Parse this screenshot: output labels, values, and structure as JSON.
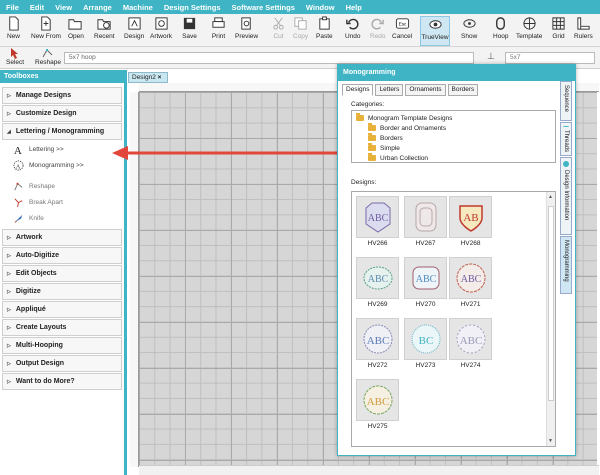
{
  "menu": [
    "File",
    "Edit",
    "View",
    "Arrange",
    "Machine",
    "Design Settings",
    "Software Settings",
    "Window",
    "Help"
  ],
  "toolbar": {
    "buttons": [
      {
        "label": "New",
        "icon": "new-file-icon"
      },
      {
        "label": "New From",
        "icon": "new-from-icon"
      },
      {
        "label": "Open",
        "icon": "open-folder-icon"
      },
      {
        "label": "Recent",
        "icon": "recent-icon"
      },
      {
        "label": "Design",
        "icon": "design-icon"
      },
      {
        "label": "Artwork",
        "icon": "artwork-icon"
      },
      {
        "label": "Save",
        "icon": "save-icon"
      },
      {
        "label": "Print",
        "icon": "print-icon"
      },
      {
        "label": "Preview",
        "icon": "preview-icon"
      },
      {
        "label": "Cut",
        "icon": "cut-icon"
      },
      {
        "label": "Copy",
        "icon": "copy-icon"
      },
      {
        "label": "Paste",
        "icon": "paste-icon"
      },
      {
        "label": "Undo",
        "icon": "undo-icon"
      },
      {
        "label": "Redo",
        "icon": "redo-icon"
      },
      {
        "label": "Cancel",
        "icon": "cancel-icon"
      },
      {
        "label": "TrueView",
        "icon": "trueview-icon"
      },
      {
        "label": "Show",
        "icon": "show-icon"
      },
      {
        "label": "Hoop",
        "icon": "hoop-icon"
      },
      {
        "label": "Template",
        "icon": "template-icon"
      },
      {
        "label": "Grid",
        "icon": "grid-icon"
      },
      {
        "label": "Rulers",
        "icon": "rulers-icon"
      }
    ]
  },
  "optbar": {
    "select": "Select",
    "reshape": "Reshape",
    "hoop_value": "5x7 hoop",
    "right_value": "5x7"
  },
  "sidebar": {
    "title": "Toolboxes",
    "sections": [
      "Manage Designs",
      "Customize Design",
      "Lettering / Monogramming",
      "Artwork",
      "Auto-Digitize",
      "Edit Objects",
      "Digitize",
      "Appliqué",
      "Create Layouts",
      "Multi-Hooping",
      "Output Design",
      "Want to do More?"
    ],
    "tools": [
      "Lettering >>",
      "Monogramming >>",
      "Reshape",
      "Break Apart",
      "Knife"
    ]
  },
  "canvas": {
    "tab": "Design2"
  },
  "panel": {
    "title": "Monogramming",
    "tabs": [
      "Designs",
      "Letters",
      "Ornaments",
      "Borders"
    ],
    "categories_label": "Categories:",
    "categories": [
      "Monogram Template Designs",
      "Border and Ornaments",
      "Borders",
      "Simple",
      "Urban Collection"
    ],
    "designs_label": "Designs:",
    "designs": [
      "HV266",
      "HV267",
      "HV268",
      "HV269",
      "HV270",
      "HV271",
      "HV272",
      "HV273",
      "HV274",
      "HV275"
    ]
  },
  "sidetabs": [
    "Sequence",
    "Threads",
    "Design Information",
    "Monogramming"
  ],
  "colors": {
    "accent": "#3fb4c4",
    "arrow": "#e2473b"
  }
}
